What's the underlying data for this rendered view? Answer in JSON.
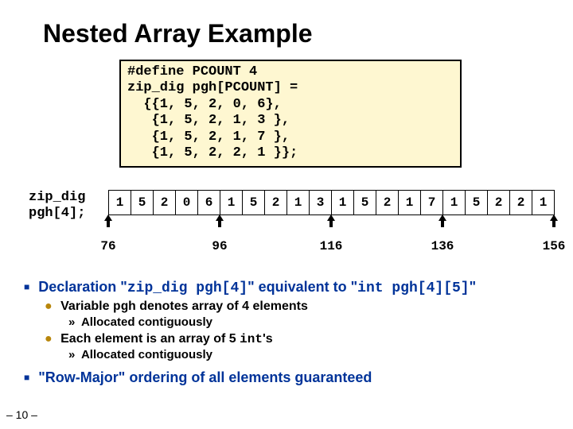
{
  "title": "Nested Array Example",
  "code": "#define PCOUNT 4\nzip_dig pgh[PCOUNT] =\n  {{1, 5, 2, 0, 6},\n   {1, 5, 2, 1, 3 },\n   {1, 5, 2, 1, 7 },\n   {1, 5, 2, 2, 1 }};",
  "mem_label": "zip_dig\npgh[4];",
  "cells": [
    "1",
    "5",
    "2",
    "0",
    "6",
    "1",
    "5",
    "2",
    "1",
    "3",
    "1",
    "5",
    "2",
    "1",
    "7",
    "1",
    "5",
    "2",
    "2",
    "1"
  ],
  "addrs": [
    "76",
    "96",
    "116",
    "136",
    "156"
  ],
  "bullet1a_pre": "Declaration \"",
  "bullet1a_code1": "zip_dig pgh[4]",
  "bullet1a_mid": "\" equivalent to \"",
  "bullet1a_code2": "int pgh[4][5]",
  "bullet1a_post": "\"",
  "bullet2a_pre": "Variable ",
  "bullet2a_code": "pgh",
  "bullet2a_post": " denotes  array of 4 elements",
  "bullet3a": "Allocated contiguously",
  "bullet2b_pre": "Each element is an array of 5 ",
  "bullet2b_code": "int",
  "bullet2b_post": "'s",
  "bullet3b": "Allocated contiguously",
  "bullet1b": "\"Row-Major\" ordering of all elements guaranteed",
  "pagenum": "– 10 –"
}
